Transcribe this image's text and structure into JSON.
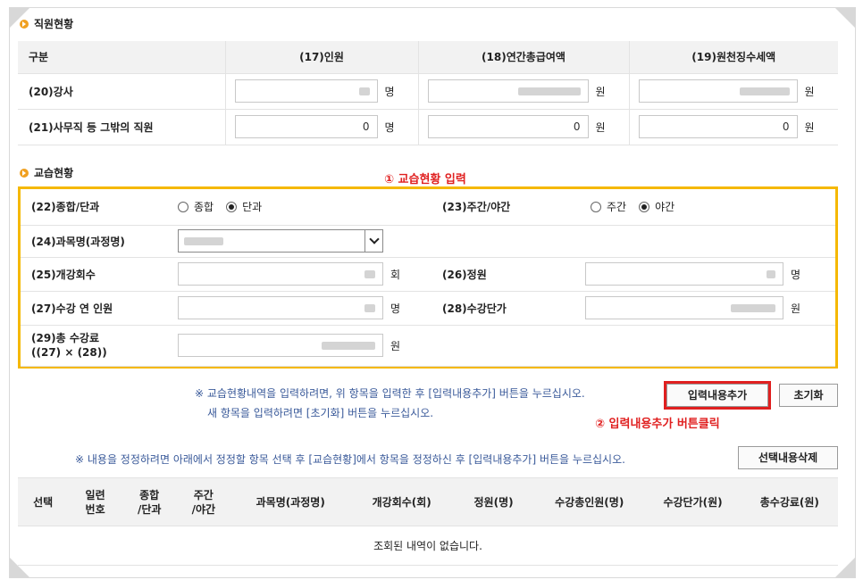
{
  "staff": {
    "title": "직원현황",
    "headers": {
      "category": "구분",
      "count": "(17)인원",
      "salary": "(18)연간총급여액",
      "tax": "(19)원천징수세액"
    },
    "rows": [
      {
        "label": "(20)강사",
        "count": "",
        "salary": "",
        "tax": ""
      },
      {
        "label": "(21)사무직 등 그밖의 직원",
        "count": "0",
        "salary": "0",
        "tax": "0"
      }
    ],
    "unit_person": "명",
    "unit_won": "원"
  },
  "training": {
    "title": "교습현황",
    "annotation1": "① 교습현황 입력",
    "type_label": "(22)종합/단과",
    "type_options": [
      "종합",
      "단과"
    ],
    "type_selected": "단과",
    "time_label": "(23)주간/야간",
    "time_options": [
      "주간",
      "야간"
    ],
    "time_selected": "야간",
    "subject_label": "(24)과목명(과정명)",
    "sessions_label": "(25)개강회수",
    "sessions_unit": "회",
    "capacity_label": "(26)정원",
    "capacity_unit": "명",
    "students_label": "(27)수강 연 인원",
    "students_unit": "명",
    "price_label": "(28)수강단가",
    "price_unit": "원",
    "total_label_1": "(29)총 수강료",
    "total_label_2": "((27) × (28))",
    "total_unit": "원"
  },
  "notes": {
    "note1": "※ 교습현황내역을 입력하려면, 위 항목을 입력한 후 [입력내용추가] 버튼을 누르십시오.",
    "note2": "새 항목을 입력하려면 [초기화] 버튼을 누르십시오.",
    "annotation2": "② 입력내용추가 버튼클릭",
    "note3": "※ 내용을 정정하려면 아래에서 정정할 항목 선택 후 [교습현황]에서 항목을 정정하신 후 [입력내용추가] 버튼을 누르십시오."
  },
  "buttons": {
    "add": "입력내용추가",
    "reset": "초기화",
    "delete": "선택내용삭제"
  },
  "list": {
    "headers": [
      "선택",
      "일련\n번호",
      "종합\n/단과",
      "주간\n/야간",
      "과목명(과정명)",
      "개강회수(회)",
      "정원(명)",
      "수강총인원(명)",
      "수강단가(원)",
      "총수강료(원)"
    ],
    "empty": "조회된 내역이 없습니다."
  },
  "colors": {
    "highlight_box": "#f5b800",
    "annotation": "#e02020",
    "note": "#3a5a9a"
  }
}
